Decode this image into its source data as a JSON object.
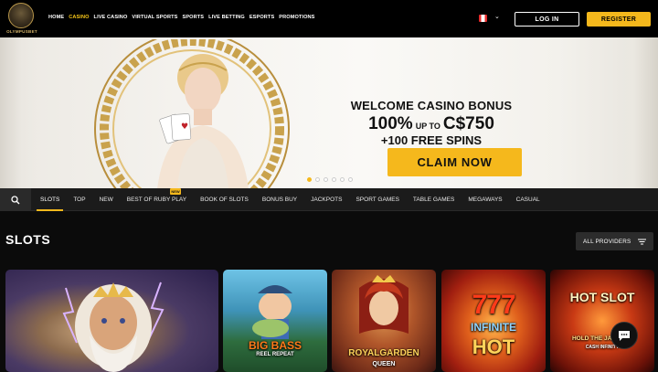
{
  "header": {
    "logo_text": "OLYMPUSBET",
    "nav": [
      "HOME",
      "CASINO",
      "LIVE CASINO",
      "VIRTUAL SPORTS",
      "SPORTS",
      "LIVE BETTING",
      "ESPORTS",
      "PROMOTIONS"
    ],
    "active_nav": "CASINO",
    "login_label": "LOG IN",
    "register_label": "REGISTER"
  },
  "hero": {
    "title": "WELCOME CASINO BONUS",
    "amount_pct": "100%",
    "amount_upto": "UP TO",
    "amount_value": "C$750",
    "spins": "+100 FREE SPINS",
    "cta": "CLAIM NOW",
    "slides_total": 6,
    "active_slide": 1
  },
  "categories": {
    "items": [
      "SLOTS",
      "TOP",
      "NEW",
      "BEST OF RUBY PLAY",
      "BOOK OF SLOTS",
      "BONUS BUY",
      "JACKPOTS",
      "SPORT GAMES",
      "TABLE GAMES",
      "MEGAWAYS",
      "CASUAL"
    ],
    "active": "SLOTS",
    "badge": "NEW"
  },
  "section": {
    "title": "SLOTS",
    "providers_label": "ALL PROVIDERS"
  },
  "games": [
    {
      "name": "zeus",
      "label": ""
    },
    {
      "name": "big-bass",
      "label": "BIG BASS",
      "sub": "REEL REPEAT"
    },
    {
      "name": "royal-garden",
      "label": "ROYALGARDEN",
      "sub": "QUEEN"
    },
    {
      "name": "infinite-777",
      "label": "777",
      "sub": "INFINITE",
      "sub2": "HOT"
    },
    {
      "name": "hot-slot",
      "label": "HOT SLOT",
      "sub": "HOLD THE JACKPOT",
      "sub2": "CASH INFINITY"
    }
  ],
  "colors": {
    "accent": "#f5b81c",
    "bg": "#0b0b0b",
    "topbar": "#000000",
    "catbar": "#1b1b1b"
  }
}
